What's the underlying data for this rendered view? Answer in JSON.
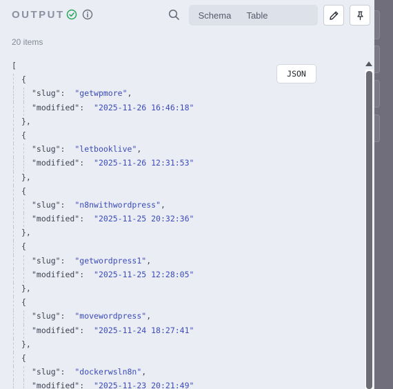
{
  "header": {
    "title": "OUTPUT",
    "tabs": [
      "Schema",
      "Table",
      "JSON"
    ],
    "active_tab": "JSON"
  },
  "item_count": "20 items",
  "json_keys": {
    "slug": "\"slug\"",
    "modified": "\"modified\""
  },
  "items": [
    {
      "slug": "getwpmore",
      "modified": "2025-11-26 16:46:18"
    },
    {
      "slug": "letbooklive",
      "modified": "2025-11-26 12:31:53"
    },
    {
      "slug": "n8nwithwordpress",
      "modified": "2025-11-25 20:32:36"
    },
    {
      "slug": "getwordpress1",
      "modified": "2025-11-25 12:28:05"
    },
    {
      "slug": "movewordpress",
      "modified": "2025-11-24 18:27:41"
    },
    {
      "slug": "dockerwsln8n",
      "modified": "2025-11-23 20:21:49"
    }
  ],
  "colors": {
    "panel": "#eaedf4",
    "success": "#26a65b",
    "string": "#3b4bb8",
    "overlay": "#6f6e7a"
  },
  "icons": {
    "status": "check-circle-icon",
    "info": "info-icon",
    "search": "search-icon",
    "edit": "pencil-icon",
    "pin": "pin-icon"
  }
}
